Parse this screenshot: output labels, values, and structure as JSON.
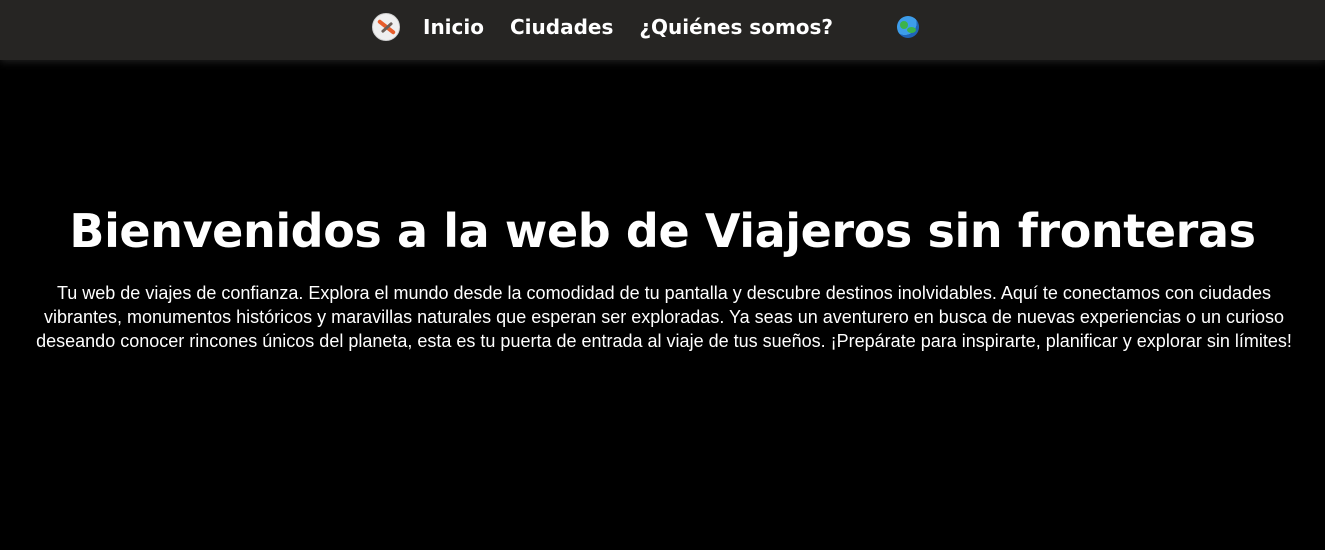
{
  "header": {
    "logo_icon": "compass-wand-logo",
    "nav_items": [
      {
        "label": "Inicio"
      },
      {
        "label": "Ciudades"
      },
      {
        "label": "¿Quiénes somos?"
      }
    ],
    "globe_icon": "globe-icon"
  },
  "hero": {
    "title": "Bienvenidos a la web de Viajeros sin fronteras",
    "description": "Tu web de viajes de confianza. Explora el mundo desde la comodidad de tu pantalla y descubre destinos inolvidables. Aquí te conectamos con ciudades vibrantes, monumentos históricos y maravillas naturales que esperan ser exploradas. Ya seas un aventurero en busca de nuevas experiencias o un curioso deseando conocer rincones únicos del planeta, esta es tu puerta de entrada al viaje de tus sueños. ¡Prepárate para inspirarte, planificar y explorar sin límites!"
  },
  "colors": {
    "navbar_background": "#262523",
    "page_background": "#000000",
    "text": "#ffffff"
  }
}
